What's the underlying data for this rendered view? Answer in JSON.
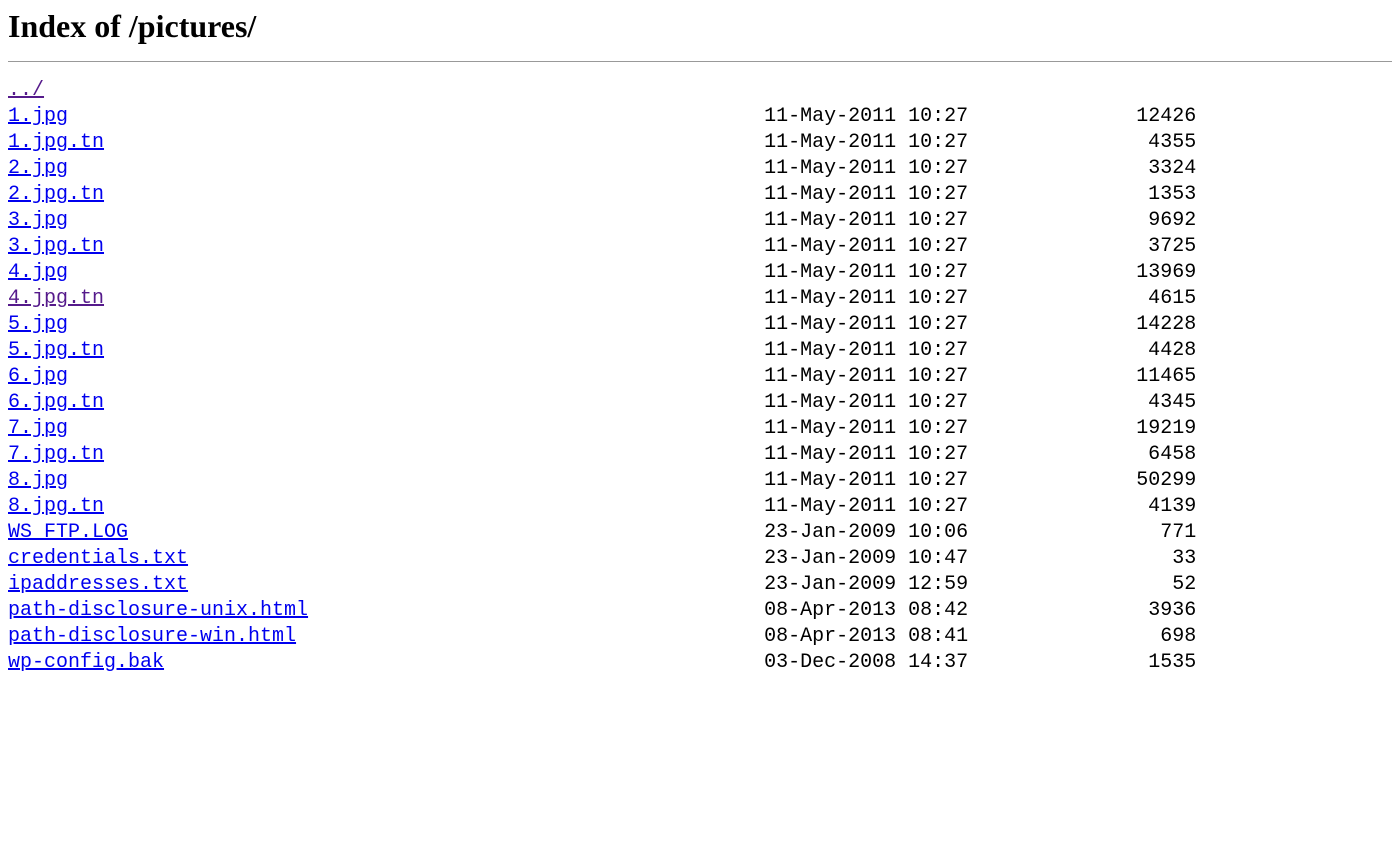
{
  "title": "Index of /pictures/",
  "parent": {
    "label": "../",
    "visited": true
  },
  "name_col_width": 63,
  "date_col_width": 17,
  "size_col_width": 19,
  "files": [
    {
      "name": "1.jpg",
      "date": "11-May-2011 10:27",
      "size": "12426",
      "visited": false
    },
    {
      "name": "1.jpg.tn",
      "date": "11-May-2011 10:27",
      "size": "4355",
      "visited": false
    },
    {
      "name": "2.jpg",
      "date": "11-May-2011 10:27",
      "size": "3324",
      "visited": false
    },
    {
      "name": "2.jpg.tn",
      "date": "11-May-2011 10:27",
      "size": "1353",
      "visited": false
    },
    {
      "name": "3.jpg",
      "date": "11-May-2011 10:27",
      "size": "9692",
      "visited": false
    },
    {
      "name": "3.jpg.tn",
      "date": "11-May-2011 10:27",
      "size": "3725",
      "visited": false
    },
    {
      "name": "4.jpg",
      "date": "11-May-2011 10:27",
      "size": "13969",
      "visited": false
    },
    {
      "name": "4.jpg.tn",
      "date": "11-May-2011 10:27",
      "size": "4615",
      "visited": true
    },
    {
      "name": "5.jpg",
      "date": "11-May-2011 10:27",
      "size": "14228",
      "visited": false
    },
    {
      "name": "5.jpg.tn",
      "date": "11-May-2011 10:27",
      "size": "4428",
      "visited": false
    },
    {
      "name": "6.jpg",
      "date": "11-May-2011 10:27",
      "size": "11465",
      "visited": false
    },
    {
      "name": "6.jpg.tn",
      "date": "11-May-2011 10:27",
      "size": "4345",
      "visited": false
    },
    {
      "name": "7.jpg",
      "date": "11-May-2011 10:27",
      "size": "19219",
      "visited": false
    },
    {
      "name": "7.jpg.tn",
      "date": "11-May-2011 10:27",
      "size": "6458",
      "visited": false
    },
    {
      "name": "8.jpg",
      "date": "11-May-2011 10:27",
      "size": "50299",
      "visited": false
    },
    {
      "name": "8.jpg.tn",
      "date": "11-May-2011 10:27",
      "size": "4139",
      "visited": false
    },
    {
      "name": "WS_FTP.LOG",
      "date": "23-Jan-2009 10:06",
      "size": "771",
      "visited": false
    },
    {
      "name": "credentials.txt",
      "date": "23-Jan-2009 10:47",
      "size": "33",
      "visited": false
    },
    {
      "name": "ipaddresses.txt",
      "date": "23-Jan-2009 12:59",
      "size": "52",
      "visited": false
    },
    {
      "name": "path-disclosure-unix.html",
      "date": "08-Apr-2013 08:42",
      "size": "3936",
      "visited": false
    },
    {
      "name": "path-disclosure-win.html",
      "date": "08-Apr-2013 08:41",
      "size": "698",
      "visited": false
    },
    {
      "name": "wp-config.bak",
      "date": "03-Dec-2008 14:37",
      "size": "1535",
      "visited": false
    }
  ]
}
